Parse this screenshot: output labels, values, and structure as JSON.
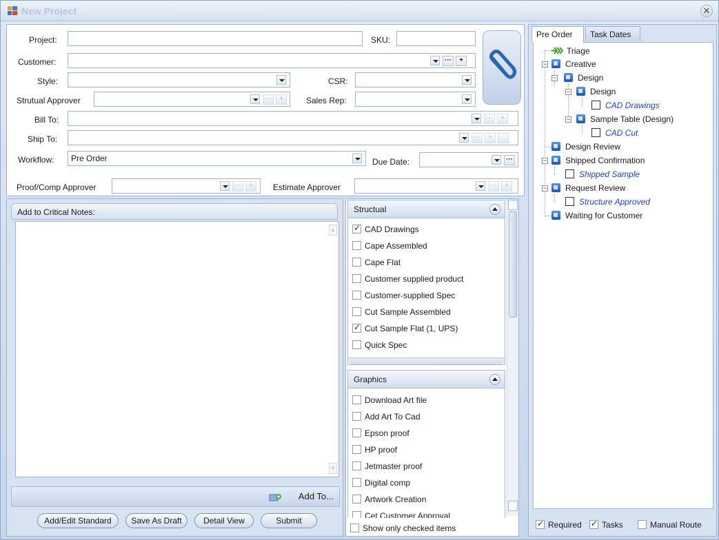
{
  "window": {
    "title": "New Project",
    "close_glyph": "✕"
  },
  "form": {
    "project_label": "Project:",
    "project_value": "",
    "sku_label": "SKU:",
    "sku_value": "",
    "customer_label": "Customer:",
    "customer_value": "",
    "style_label": "Style:",
    "style_value": "",
    "csr_label": "CSR:",
    "csr_value": "",
    "structural_approver_label": "Strutual Approver",
    "structural_approver_value": "",
    "sales_rep_label": "Sales Rep:",
    "sales_rep_value": "",
    "bill_to_label": "Bill To:",
    "bill_to_value": "",
    "ship_to_label": "Ship To:",
    "ship_to_value": "",
    "workflow_label": "Workflow:",
    "workflow_value": "Pre Order",
    "due_date_label": "Due Date:",
    "due_date_value": "",
    "proof_approver_label": "Proof/Comp Approver",
    "proof_approver_value": "",
    "estimate_approver_label": "Estimate Approver",
    "estimate_approver_value": "",
    "ellipsis": "···",
    "plus": "+"
  },
  "notes": {
    "header": "Add to Critical Notes:",
    "add_to": "Add To...",
    "buttons": [
      "Add/Edit Standard",
      "Save As Draft",
      "Detail View",
      "Submit"
    ]
  },
  "checklists": {
    "structual": {
      "title": "Structual",
      "items": [
        {
          "label": "CAD Drawings",
          "checked": true
        },
        {
          "label": "Cape Assembled",
          "checked": false
        },
        {
          "label": "Cape Flat",
          "checked": false
        },
        {
          "label": "Customer supplied product",
          "checked": false
        },
        {
          "label": "Customer-supplied Spec",
          "checked": false
        },
        {
          "label": "Cut Sample Assembled",
          "checked": false
        },
        {
          "label": "Cut Sample Flat (1, UPS)",
          "checked": true
        },
        {
          "label": "Quick Spec",
          "checked": false
        }
      ]
    },
    "graphics": {
      "title": "Graphics",
      "items": [
        {
          "label": "Download Art file",
          "checked": false
        },
        {
          "label": "Add Art To Cad",
          "checked": false
        },
        {
          "label": "Epson proof",
          "checked": false
        },
        {
          "label": "HP proof",
          "checked": false
        },
        {
          "label": "Jetmaster proof",
          "checked": false
        },
        {
          "label": "Digital comp",
          "checked": false
        },
        {
          "label": "Artwork Creation",
          "checked": false
        },
        {
          "label": "Cet Customer Approval",
          "checked": false
        }
      ]
    },
    "show_only_checked": "Show only checked items"
  },
  "right": {
    "tabs": [
      "Pre Order",
      "Task Dates"
    ],
    "tree": {
      "triage": "Triage",
      "creative": "Creative",
      "design_group": "Design",
      "design": "Design",
      "cad_drawings": "CAD Drawings",
      "sample_table": "Sample Table (Design)",
      "cad_cut": "CAD Cut",
      "design_review": "Design Review",
      "shipped_confirmation": "Shipped Confirmation",
      "shipped_sample": "Shipped Sample",
      "request_review": "Request Review",
      "structure_approved": "Structure Approved",
      "waiting_for_customer": "Waiting for Customer"
    },
    "footer": {
      "required": "Required",
      "tasks": "Tasks",
      "manual_route": "Manual Route",
      "required_checked": true,
      "tasks_checked": true,
      "manual_route_checked": false
    }
  }
}
